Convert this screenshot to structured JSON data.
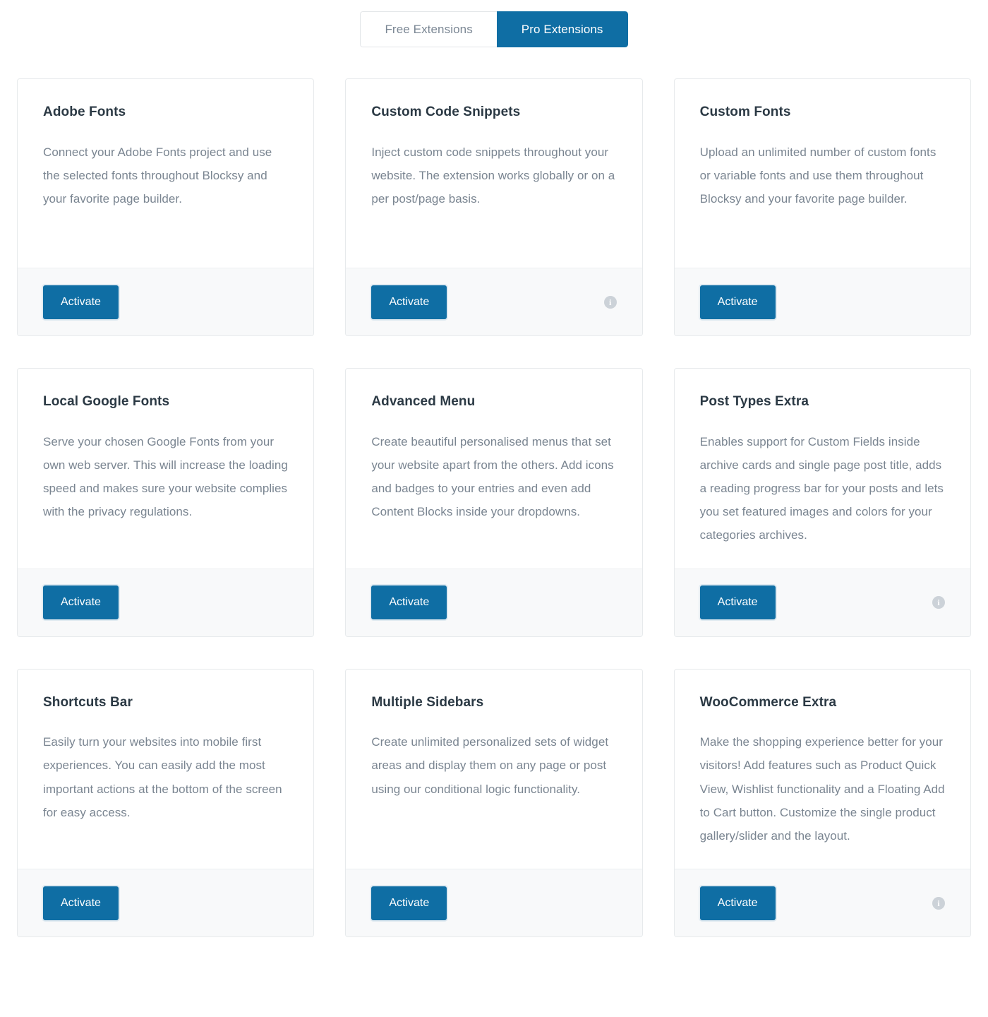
{
  "tabs": [
    {
      "label": "Free Extensions",
      "active": false
    },
    {
      "label": "Pro Extensions",
      "active": true
    }
  ],
  "colors": {
    "accent": "#0f6ea4",
    "card_border": "#e7eaec",
    "footer_bg": "#f8f9fa",
    "title_text": "#2b3944",
    "body_text": "#7a8591",
    "info_icon": "#ccd2d8"
  },
  "common": {
    "activate_label": "Activate",
    "info_glyph": "i"
  },
  "extensions": [
    {
      "title": "Adobe Fonts",
      "description": "Connect your Adobe Fonts project and use the selected fonts throughout Blocksy and your favorite page builder.",
      "action": "Activate",
      "has_info": false
    },
    {
      "title": "Custom Code Snippets",
      "description": "Inject custom code snippets throughout your website. The extension works globally or on a per post/page basis.",
      "action": "Activate",
      "has_info": true
    },
    {
      "title": "Custom Fonts",
      "description": "Upload an unlimited number of custom fonts or variable fonts and use them throughout Blocksy and your favorite page builder.",
      "action": "Activate",
      "has_info": false
    },
    {
      "title": "Local Google Fonts",
      "description": "Serve your chosen Google Fonts from your own web server. This will increase the loading speed and makes sure your website complies with the privacy regulations.",
      "action": "Activate",
      "has_info": false
    },
    {
      "title": "Advanced Menu",
      "description": "Create beautiful personalised menus that set your website apart from the others. Add icons and badges to your entries and even add Content Blocks inside your dropdowns.",
      "action": "Activate",
      "has_info": false
    },
    {
      "title": "Post Types Extra",
      "description": "Enables support for Custom Fields inside archive cards and single page post title, adds a reading progress bar for your posts and lets you set featured images and colors for your categories archives.",
      "action": "Activate",
      "has_info": true
    },
    {
      "title": "Shortcuts Bar",
      "description": "Easily turn your websites into mobile first experiences. You can easily add the most important actions at the bottom of the screen for easy access.",
      "action": "Activate",
      "has_info": false
    },
    {
      "title": "Multiple Sidebars",
      "description": "Create unlimited personalized sets of widget areas and display them on any page or post using our conditional logic functionality.",
      "action": "Activate",
      "has_info": false
    },
    {
      "title": "WooCommerce Extra",
      "description": "Make the shopping experience better for your visitors! Add features such as Product Quick View, Wishlist functionality and a Floating Add to Cart button. Customize the single product gallery/slider and the layout.",
      "action": "Activate",
      "has_info": true
    }
  ]
}
